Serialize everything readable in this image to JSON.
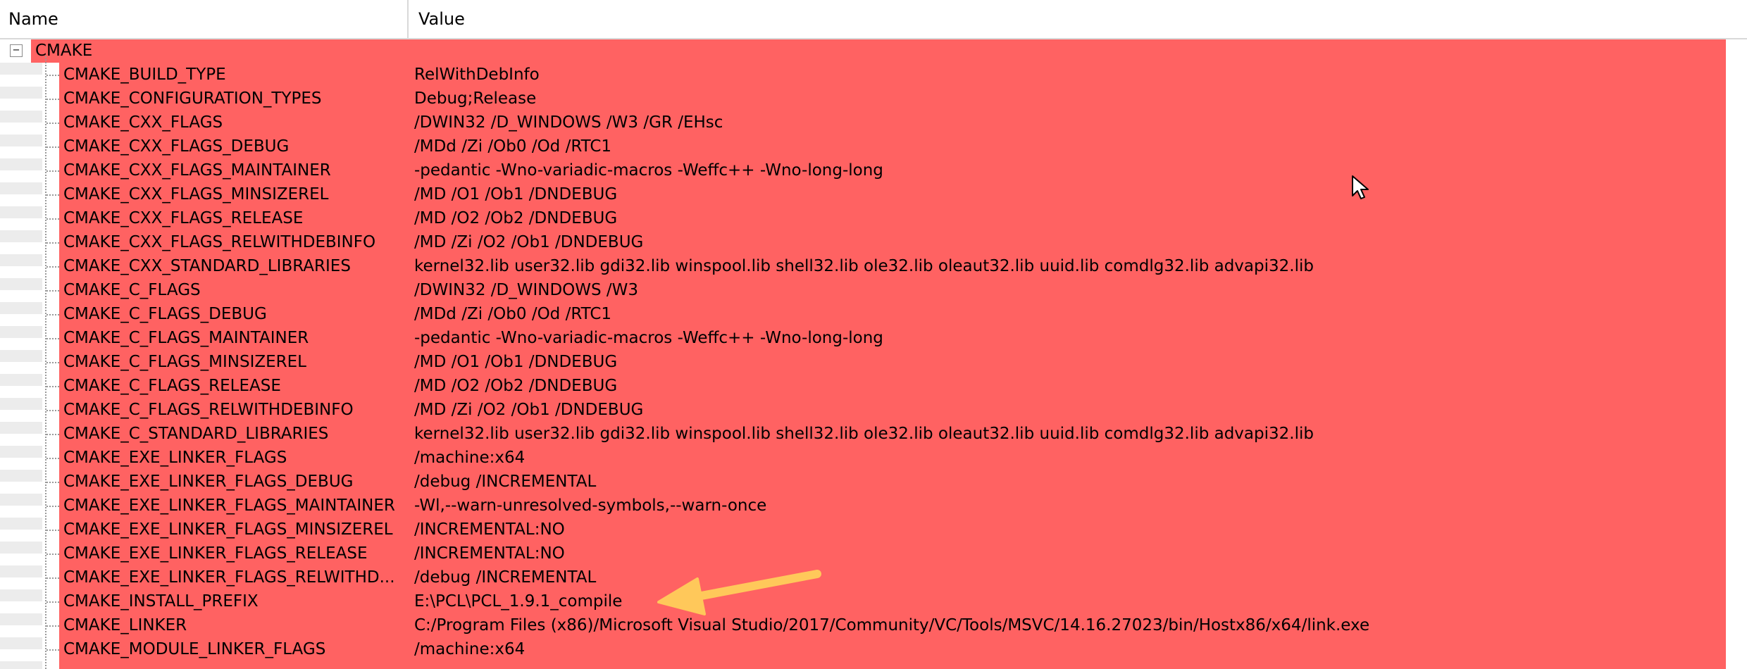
{
  "columns": {
    "name": "Name",
    "value": "Value"
  },
  "root": {
    "label": "CMAKE",
    "expander": "−"
  },
  "rows": [
    {
      "name": "CMAKE_BUILD_TYPE",
      "value": "RelWithDebInfo"
    },
    {
      "name": "CMAKE_CONFIGURATION_TYPES",
      "value": "Debug;Release"
    },
    {
      "name": "CMAKE_CXX_FLAGS",
      "value": "/DWIN32 /D_WINDOWS /W3 /GR /EHsc"
    },
    {
      "name": "CMAKE_CXX_FLAGS_DEBUG",
      "value": "/MDd /Zi /Ob0 /Od /RTC1"
    },
    {
      "name": "CMAKE_CXX_FLAGS_MAINTAINER",
      "value": "-pedantic -Wno-variadic-macros -Weffc++ -Wno-long-long"
    },
    {
      "name": "CMAKE_CXX_FLAGS_MINSIZEREL",
      "value": "/MD /O1 /Ob1 /DNDEBUG"
    },
    {
      "name": "CMAKE_CXX_FLAGS_RELEASE",
      "value": "/MD /O2 /Ob2 /DNDEBUG"
    },
    {
      "name": "CMAKE_CXX_FLAGS_RELWITHDEBINFO",
      "value": "/MD /Zi /O2 /Ob1 /DNDEBUG"
    },
    {
      "name": "CMAKE_CXX_STANDARD_LIBRARIES",
      "value": "kernel32.lib user32.lib gdi32.lib winspool.lib shell32.lib ole32.lib oleaut32.lib uuid.lib comdlg32.lib advapi32.lib"
    },
    {
      "name": "CMAKE_C_FLAGS",
      "value": "/DWIN32 /D_WINDOWS /W3"
    },
    {
      "name": "CMAKE_C_FLAGS_DEBUG",
      "value": "/MDd /Zi /Ob0 /Od /RTC1"
    },
    {
      "name": "CMAKE_C_FLAGS_MAINTAINER",
      "value": "-pedantic -Wno-variadic-macros -Weffc++ -Wno-long-long"
    },
    {
      "name": "CMAKE_C_FLAGS_MINSIZEREL",
      "value": "/MD /O1 /Ob1 /DNDEBUG"
    },
    {
      "name": "CMAKE_C_FLAGS_RELEASE",
      "value": "/MD /O2 /Ob2 /DNDEBUG"
    },
    {
      "name": "CMAKE_C_FLAGS_RELWITHDEBINFO",
      "value": "/MD /Zi /O2 /Ob1 /DNDEBUG"
    },
    {
      "name": "CMAKE_C_STANDARD_LIBRARIES",
      "value": "kernel32.lib user32.lib gdi32.lib winspool.lib shell32.lib ole32.lib oleaut32.lib uuid.lib comdlg32.lib advapi32.lib"
    },
    {
      "name": "CMAKE_EXE_LINKER_FLAGS",
      "value": "/machine:x64"
    },
    {
      "name": "CMAKE_EXE_LINKER_FLAGS_DEBUG",
      "value": "/debug /INCREMENTAL"
    },
    {
      "name": "CMAKE_EXE_LINKER_FLAGS_MAINTAINER",
      "value": "-Wl,--warn-unresolved-symbols,--warn-once"
    },
    {
      "name": "CMAKE_EXE_LINKER_FLAGS_MINSIZEREL",
      "value": "/INCREMENTAL:NO"
    },
    {
      "name": "CMAKE_EXE_LINKER_FLAGS_RELEASE",
      "value": "/INCREMENTAL:NO"
    },
    {
      "name": "CMAKE_EXE_LINKER_FLAGS_RELWITHD...",
      "value": "/debug /INCREMENTAL"
    },
    {
      "name": "CMAKE_INSTALL_PREFIX",
      "value": "E:\\PCL\\PCL_1.9.1_compile"
    },
    {
      "name": "CMAKE_LINKER",
      "value": "C:/Program Files (x86)/Microsoft Visual Studio/2017/Community/VC/Tools/MSVC/14.16.27023/bin/Hostx86/x64/link.exe"
    },
    {
      "name": "CMAKE_MODULE_LINKER_FLAGS",
      "value": "/machine:x64"
    }
  ],
  "colors": {
    "highlight": "#ff6262",
    "annotation_arrow": "#ffc85a"
  },
  "icons": {
    "expander": "collapse-icon",
    "cursor": "mouse-pointer-icon",
    "annotation": "annotation-arrow-icon"
  }
}
